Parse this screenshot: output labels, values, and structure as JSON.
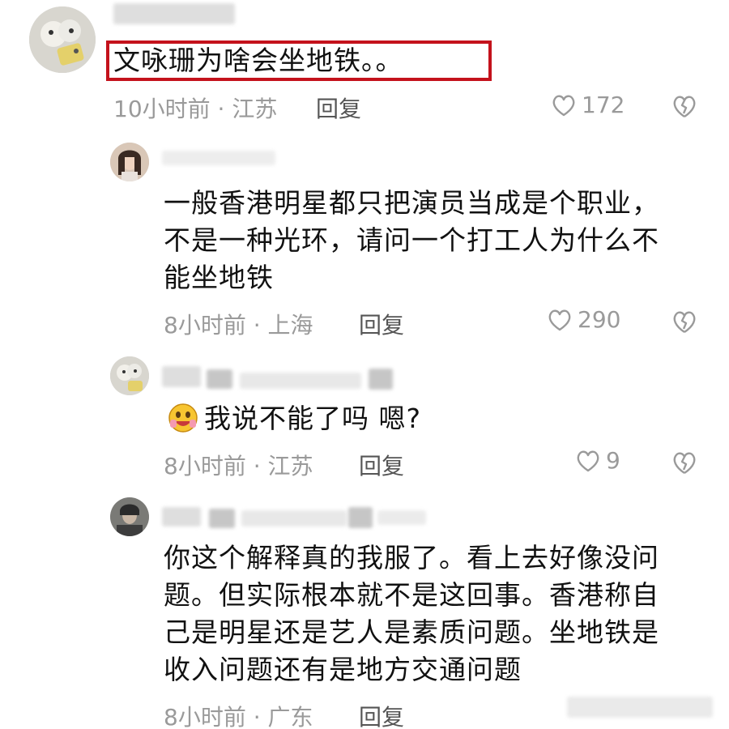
{
  "comments": [
    {
      "text": "文咏珊为啥会坐地铁。。",
      "time": "10小时前",
      "location": "江苏",
      "reply_label": "回复",
      "likes": "172"
    },
    {
      "text_lines": [
        "一般香港明星都只把演员当成是个职业，",
        "不是一种光环，请问一个打工人为什么不",
        "能坐地铁"
      ],
      "time": "8小时前",
      "location": "上海",
      "reply_label": "回复",
      "likes": "290"
    },
    {
      "text": "我说不能了吗  嗯?",
      "time": "8小时前",
      "location": "江苏",
      "reply_label": "回复",
      "likes": "9"
    },
    {
      "text_lines": [
        "你这个解释真的我服了。看上去好像没问",
        "题。但实际根本就不是这回事。香港称自",
        "己是明星还是艺人是素质问题。坐地铁是",
        "收入问题还有是地方交通问题"
      ],
      "time": "8小时前",
      "location": "广东",
      "reply_label": "回复"
    }
  ],
  "separator": "·",
  "colors": {
    "highlight": "#c4121c",
    "meta": "#9a9a9a"
  }
}
